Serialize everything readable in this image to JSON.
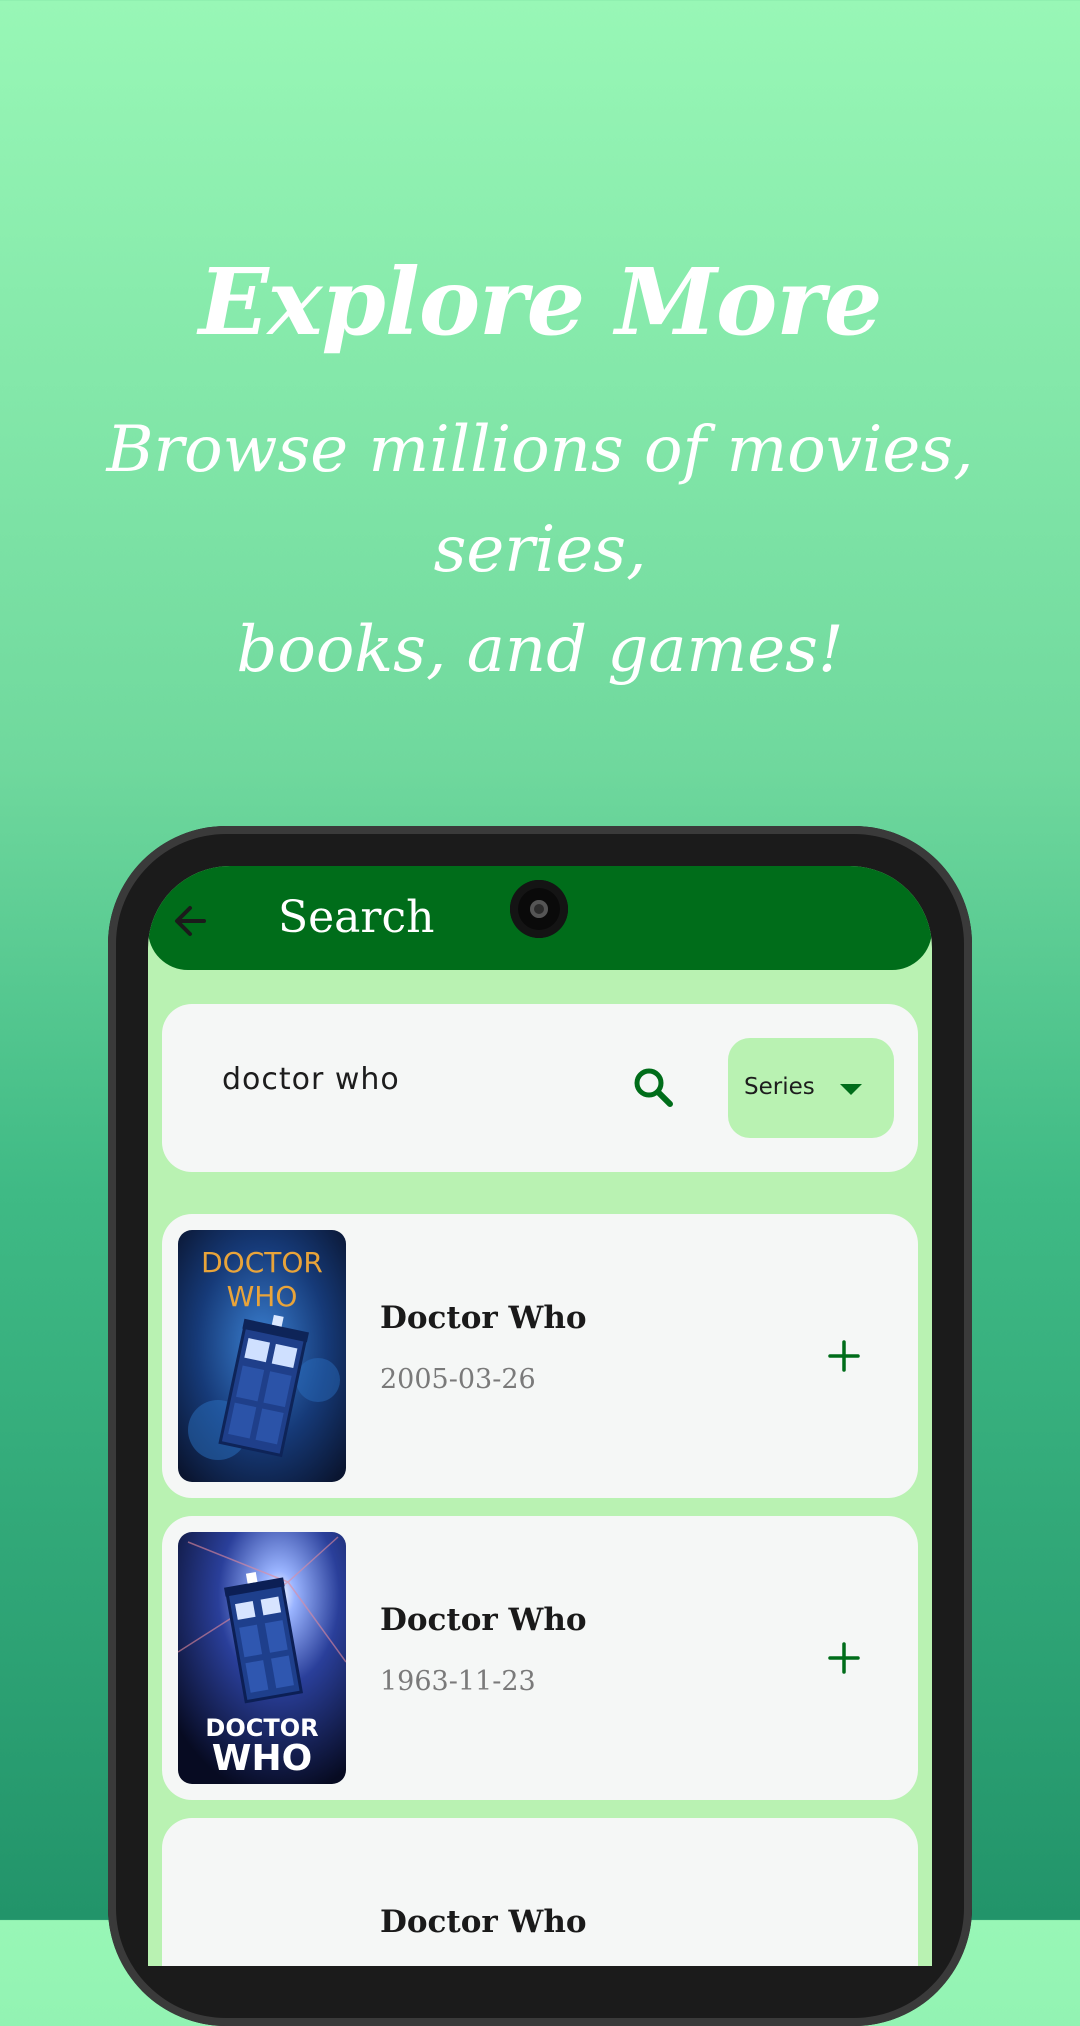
{
  "promo": {
    "title": "Explore More",
    "subtitle_line1": "Browse millions of movies, series,",
    "subtitle_line2": "books, and games!"
  },
  "appbar": {
    "title": "Search",
    "back_icon": "arrow-left-icon"
  },
  "search": {
    "query": "doctor who",
    "search_icon": "search-icon",
    "type_selected": "Series"
  },
  "results": [
    {
      "title": "Doctor Who",
      "date": "2005-03-26",
      "poster_text": [
        "DOCTOR",
        "WHO"
      ]
    },
    {
      "title": "Doctor Who",
      "date": "1963-11-23",
      "poster_text": [
        "DOCTOR",
        "WHO"
      ]
    },
    {
      "title": "Doctor Who",
      "date": ""
    }
  ],
  "colors": {
    "accent": "#006d1a",
    "screen_bg": "#b9f2b2",
    "card_bg": "#f5f7f6"
  }
}
